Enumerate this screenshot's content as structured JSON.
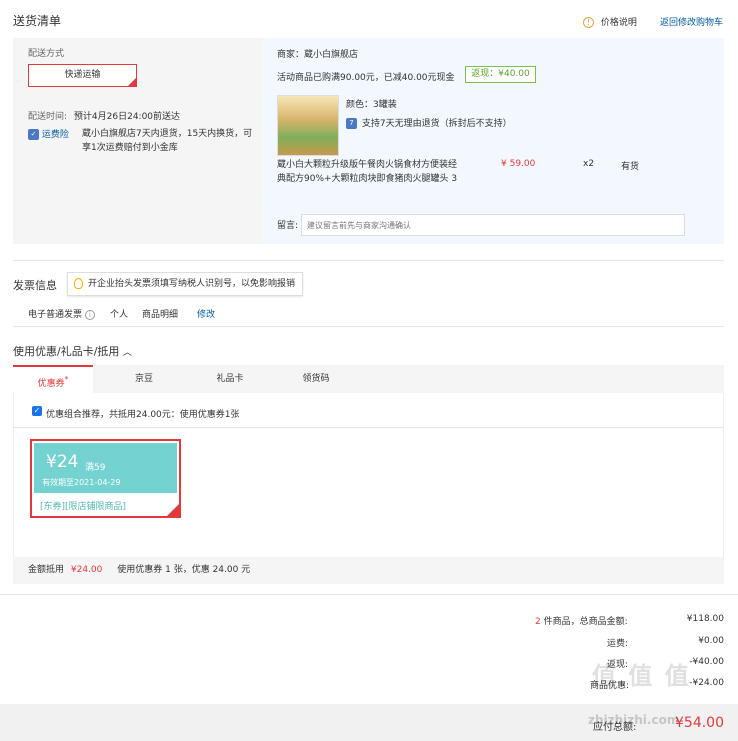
{
  "header": {
    "title": "送货清单",
    "price_help": "价格说明",
    "back_to_cart": "返回修改购物车"
  },
  "shipping": {
    "method_label": "配送方式",
    "method_value": "快递运输",
    "time_label": "配送时间:",
    "time_value": "预计4月26日24:00前送达",
    "insurance_label": "运费险",
    "insurance_desc_1": "蔵小白旗舰店7天内退货，15天内换货，可",
    "insurance_desc_2": "享1次运费赔付到小金库"
  },
  "order": {
    "shop": "商家：蔵小白旗舰店",
    "promo": "活动商品已购满90.00元，已减40.00元现金",
    "rebate": "返现：¥40.00",
    "color_spec": "颜色：3罐装",
    "return_policy": "支持7天无理由退货（拆封后不支持）",
    "product_name_1": "蔵小白大颗粒升级版午餐肉火锅食材方便装经",
    "product_name_2": "典配方90%+大颗粒肉块即食猪肉火腿罐头 3",
    "price": "¥ 59.00",
    "quantity": "x2",
    "stock": "有货",
    "message_label": "留言:",
    "message_placeholder": "建议留言前先与商家沟通确认"
  },
  "invoice": {
    "title": "发票信息",
    "tip": "开企业抬头发票须填写纳税人识别号，以免影响报销",
    "type": "电子普通发票",
    "person": "个人",
    "detail": "商品明细",
    "edit": "修改"
  },
  "coupons": {
    "title": "使用优惠/礼品卡/抵用",
    "tabs": [
      {
        "label": "优惠券"
      },
      {
        "label": "京豆"
      },
      {
        "label": "礼品卡"
      },
      {
        "label": "领货码"
      }
    ],
    "recommend_text": "优惠组合推荐，共抵用24.00元：使用优惠券1张",
    "card": {
      "amount": "¥24",
      "threshold": "满59",
      "expiry": "有效期至2021-04-29",
      "tag": "[东券]",
      "scope": "[限店铺限商品]"
    },
    "summary_label": "金额抵用",
    "summary_amount": "¥24.00",
    "summary_detail": "使用优惠券 1 张，优惠 24.00 元"
  },
  "totals": {
    "count": "2",
    "count_text": "件商品，总商品金额:",
    "goods_amount": "¥118.00",
    "shipping_label": "运费:",
    "shipping_amount": "¥0.00",
    "cashback_label": "返现:",
    "cashback_amount": "-¥40.00",
    "coupon_label": "商品优惠:",
    "coupon_amount": "-¥24.00",
    "pay_label": "应付总额:",
    "pay_amount": "¥54.00"
  },
  "watermark": {
    "logo": "值 值 值",
    "site": "zhizhizhi.com"
  }
}
